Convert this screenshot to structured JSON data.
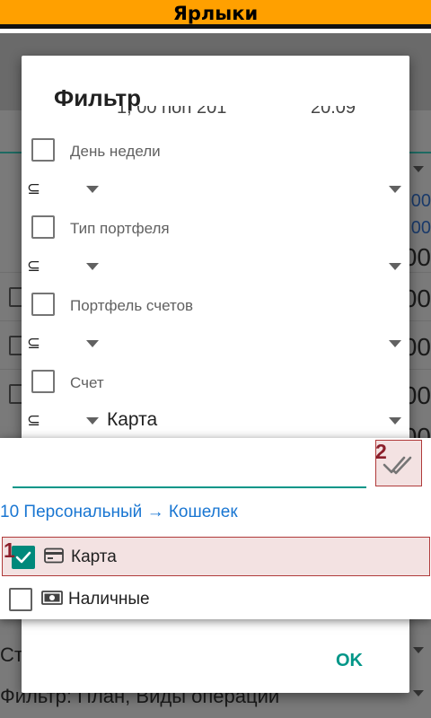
{
  "app_title": "Ярлыки",
  "background": {
    "numbers": [
      "00",
      "00",
      "00",
      "00",
      "00",
      "00",
      "00"
    ],
    "bottom_row1": "Ст",
    "bottom_row2": "Фильтр: План, Виды операций"
  },
  "dialog": {
    "title": "Фильтр",
    "clipped_left": "1, 00 non 201",
    "clipped_right": "20.09",
    "rows": [
      {
        "label": "День недели",
        "operator": "⊆",
        "value": ""
      },
      {
        "label": "Тип портфеля",
        "operator": "⊆",
        "value": ""
      },
      {
        "label": "Портфель счетов",
        "operator": "⊆",
        "value": ""
      },
      {
        "label": "Счет",
        "operator": "⊆",
        "value": "Карта"
      }
    ],
    "ok_label": "OK"
  },
  "popup": {
    "search_value": "",
    "search_placeholder": "",
    "marker_check_all": "2",
    "marker_selected": "1",
    "path_text": "10 Персональный → Кошелек",
    "options": [
      {
        "label": "Карта",
        "checked": true,
        "icon": "credit-card-icon"
      },
      {
        "label": "Наличные",
        "checked": false,
        "icon": "cash-icon"
      }
    ]
  },
  "colors": {
    "accent": "#009688",
    "title_bar": "#ffa000",
    "link": "#1976d2",
    "highlight_border": "#b03a3a",
    "marker": "#8b1f2b"
  }
}
